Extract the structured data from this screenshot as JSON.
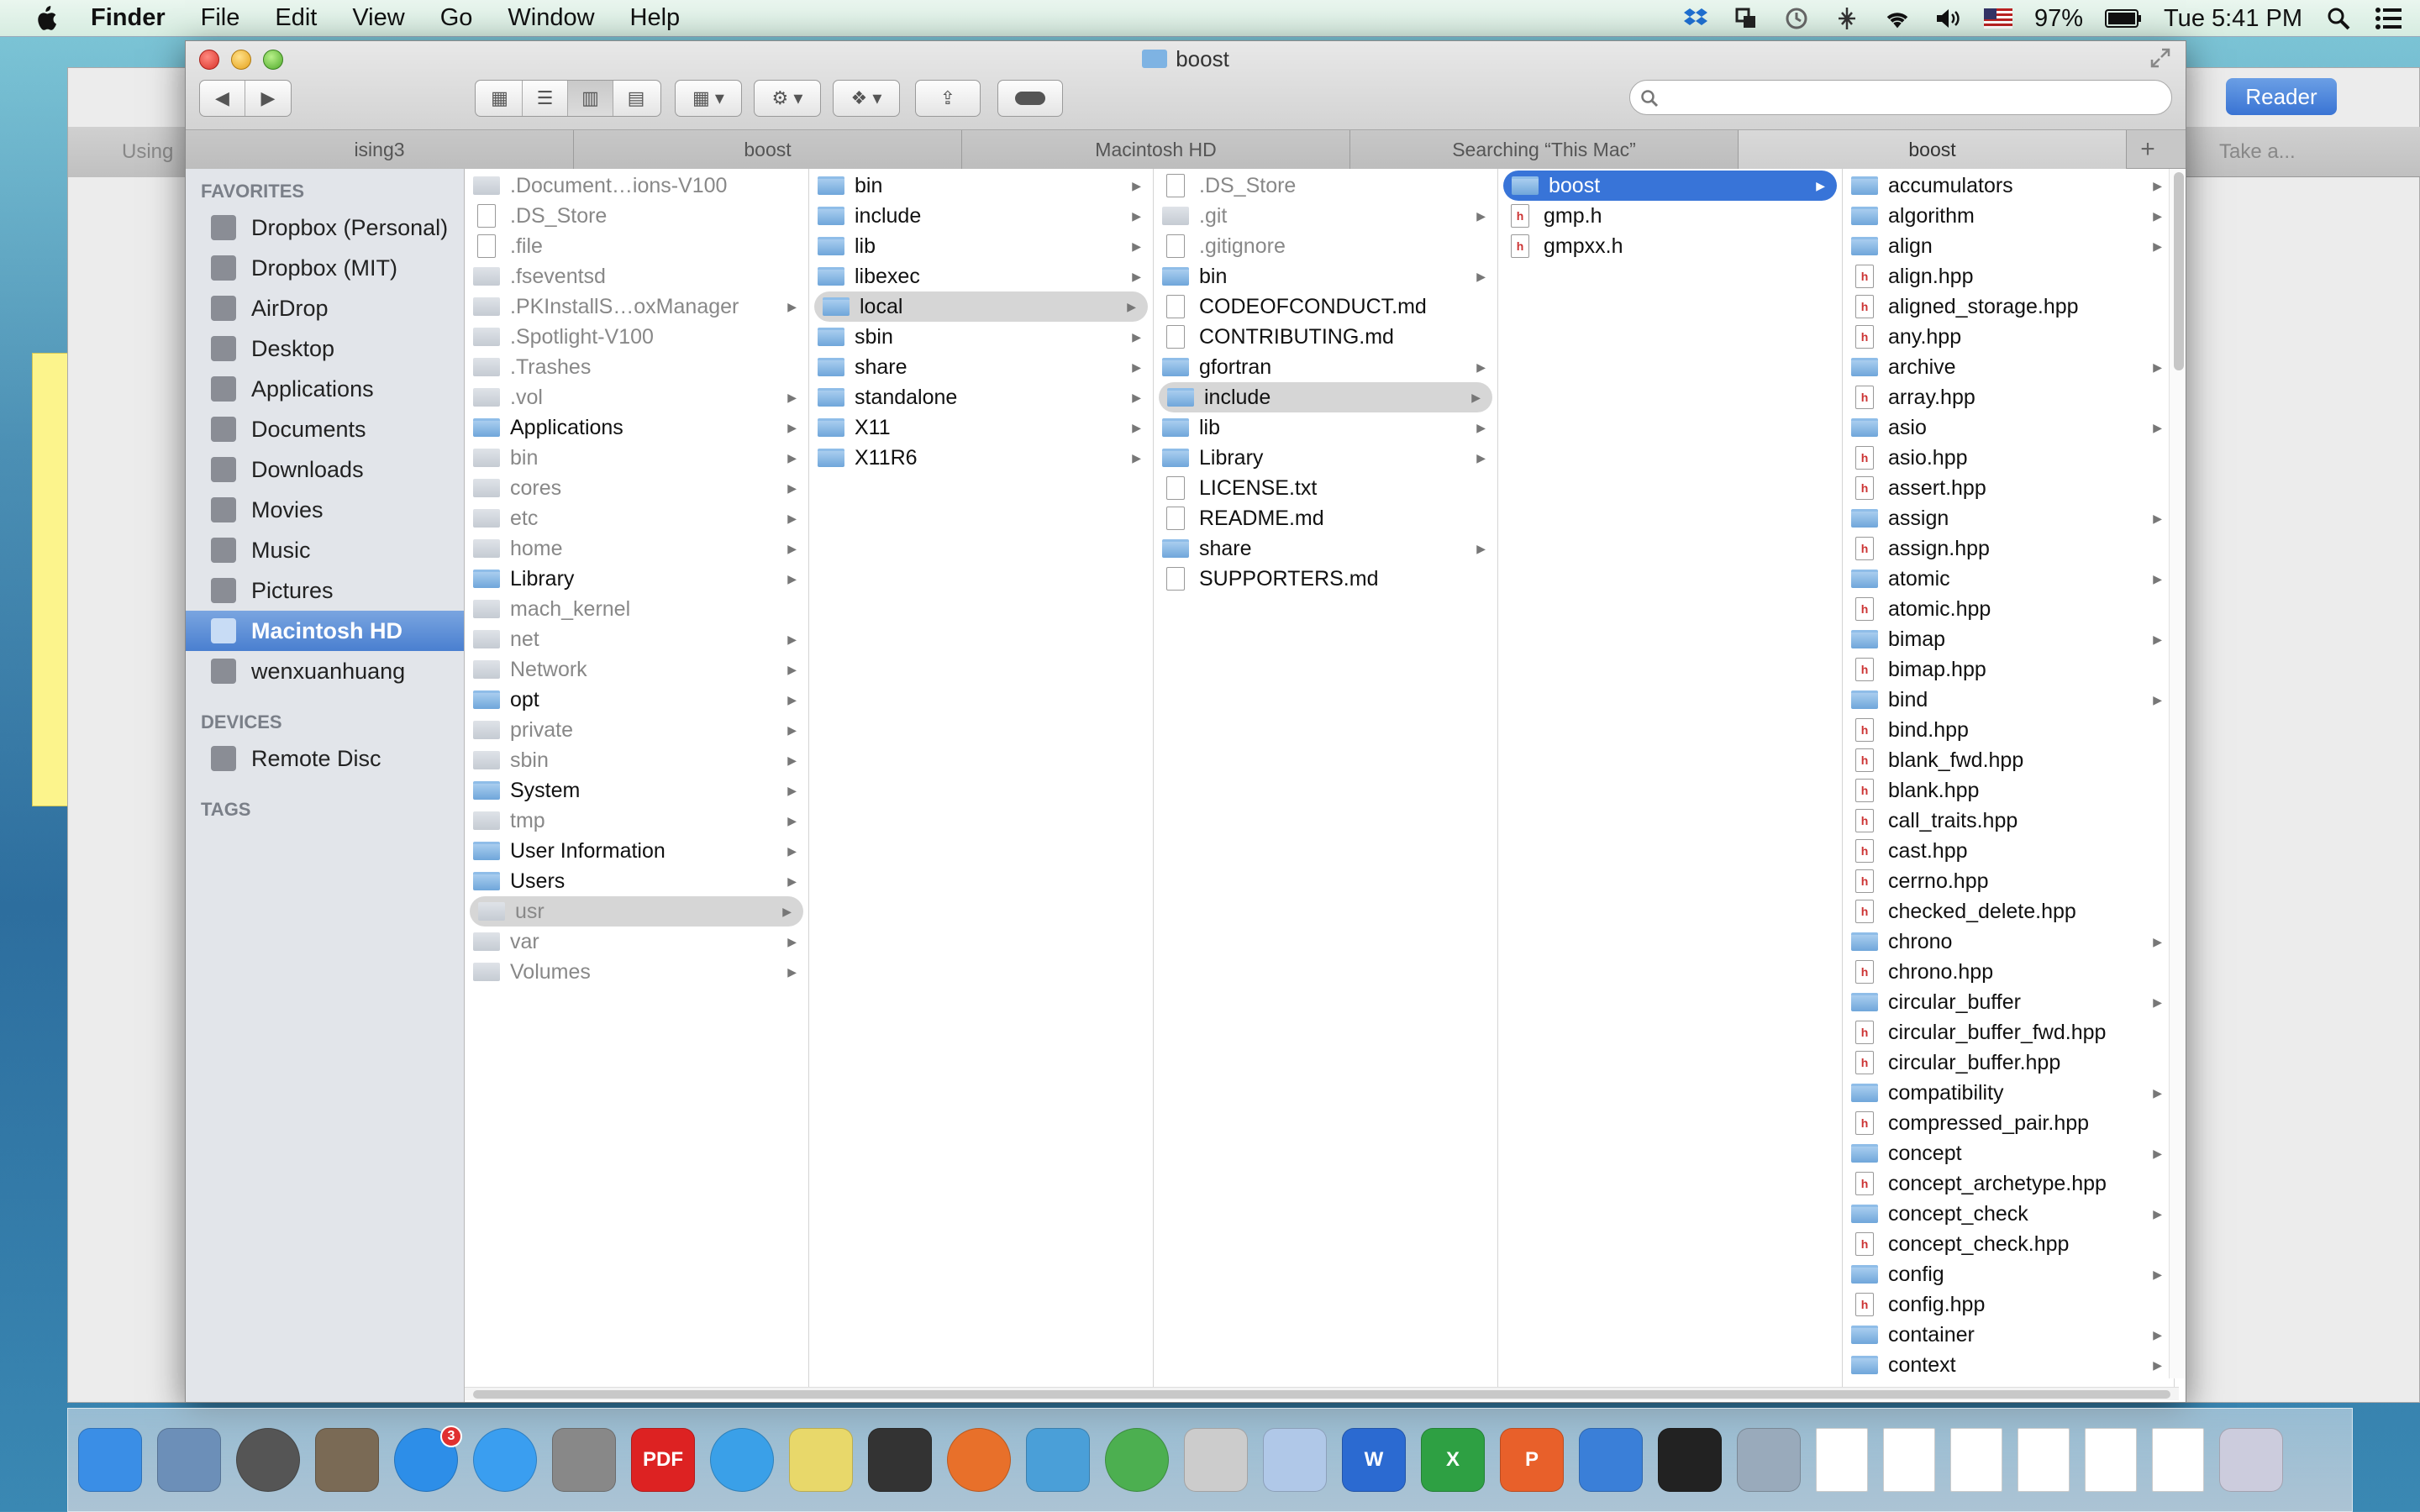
{
  "menubar": {
    "app": "Finder",
    "items": [
      "File",
      "Edit",
      "View",
      "Go",
      "Window",
      "Help"
    ],
    "battery": "97%",
    "clock": "Tue 5:41 PM"
  },
  "window": {
    "title": "boost"
  },
  "bg_right": {
    "tab": "Take a...",
    "reader": "Reader"
  },
  "bg_left": {
    "tab": "Using"
  },
  "tabs": [
    "ising3",
    "boost",
    "Macintosh HD",
    "Searching “This Mac”",
    "boost"
  ],
  "sidebar": {
    "favorites_header": "FAVORITES",
    "favorites": [
      {
        "label": "Dropbox (Personal)",
        "icon": "dropbox-icon"
      },
      {
        "label": "Dropbox (MIT)",
        "icon": "dropbox-icon"
      },
      {
        "label": "AirDrop",
        "icon": "airdrop-icon"
      },
      {
        "label": "Desktop",
        "icon": "desktop-icon"
      },
      {
        "label": "Applications",
        "icon": "applications-icon"
      },
      {
        "label": "Documents",
        "icon": "documents-icon"
      },
      {
        "label": "Downloads",
        "icon": "downloads-icon"
      },
      {
        "label": "Movies",
        "icon": "movies-icon"
      },
      {
        "label": "Music",
        "icon": "music-icon"
      },
      {
        "label": "Pictures",
        "icon": "pictures-icon"
      },
      {
        "label": "Macintosh HD",
        "icon": "harddisk-icon"
      },
      {
        "label": "wenxuanhuang",
        "icon": "home-icon"
      }
    ],
    "devices_header": "DEVICES",
    "devices": [
      {
        "label": "Remote Disc",
        "icon": "disc-icon"
      }
    ],
    "tags_header": "TAGS"
  },
  "columns": [
    [
      {
        "name": ".Document…ions-V100",
        "kind": "gfolder",
        "dim": true
      },
      {
        "name": ".DS_Store",
        "kind": "doc",
        "dim": true
      },
      {
        "name": ".file",
        "kind": "doc",
        "dim": true
      },
      {
        "name": ".fseventsd",
        "kind": "gfolder",
        "dim": true
      },
      {
        "name": ".PKInstallS…oxManager",
        "kind": "gfolder",
        "dim": true,
        "arrow": true
      },
      {
        "name": ".Spotlight-V100",
        "kind": "gfolder",
        "dim": true
      },
      {
        "name": ".Trashes",
        "kind": "gfolder",
        "dim": true
      },
      {
        "name": ".vol",
        "kind": "gfolder",
        "dim": true,
        "arrow": true
      },
      {
        "name": "Applications",
        "kind": "folder",
        "arrow": true
      },
      {
        "name": "bin",
        "kind": "gfolder",
        "dim": true,
        "arrow": true
      },
      {
        "name": "cores",
        "kind": "gfolder",
        "dim": true,
        "arrow": true
      },
      {
        "name": "etc",
        "kind": "gfolder",
        "dim": true,
        "arrow": true
      },
      {
        "name": "home",
        "kind": "gfolder",
        "dim": true,
        "arrow": true
      },
      {
        "name": "Library",
        "kind": "folder",
        "arrow": true
      },
      {
        "name": "mach_kernel",
        "kind": "gfolder",
        "dim": true
      },
      {
        "name": "net",
        "kind": "gfolder",
        "dim": true,
        "arrow": true
      },
      {
        "name": "Network",
        "kind": "gfolder",
        "dim": true,
        "arrow": true
      },
      {
        "name": "opt",
        "kind": "folder",
        "arrow": true
      },
      {
        "name": "private",
        "kind": "gfolder",
        "dim": true,
        "arrow": true
      },
      {
        "name": "sbin",
        "kind": "gfolder",
        "dim": true,
        "arrow": true
      },
      {
        "name": "System",
        "kind": "folder",
        "arrow": true
      },
      {
        "name": "tmp",
        "kind": "gfolder",
        "dim": true,
        "arrow": true
      },
      {
        "name": "User Information",
        "kind": "folder",
        "arrow": true
      },
      {
        "name": "Users",
        "kind": "folder",
        "arrow": true
      },
      {
        "name": "usr",
        "kind": "gfolder",
        "dim": true,
        "arrow": true,
        "state": "hl"
      },
      {
        "name": "var",
        "kind": "gfolder",
        "dim": true,
        "arrow": true
      },
      {
        "name": "Volumes",
        "kind": "gfolder",
        "dim": true,
        "arrow": true
      }
    ],
    [
      {
        "name": "bin",
        "kind": "folder",
        "arrow": true
      },
      {
        "name": "include",
        "kind": "folder",
        "arrow": true
      },
      {
        "name": "lib",
        "kind": "folder",
        "arrow": true
      },
      {
        "name": "libexec",
        "kind": "folder",
        "arrow": true
      },
      {
        "name": "local",
        "kind": "folder",
        "arrow": true,
        "state": "hl"
      },
      {
        "name": "sbin",
        "kind": "folder",
        "arrow": true
      },
      {
        "name": "share",
        "kind": "folder",
        "arrow": true
      },
      {
        "name": "standalone",
        "kind": "folder",
        "arrow": true
      },
      {
        "name": "X11",
        "kind": "folder",
        "arrow": true
      },
      {
        "name": "X11R6",
        "kind": "folder",
        "arrow": true
      }
    ],
    [
      {
        "name": ".DS_Store",
        "kind": "doc",
        "dim": true
      },
      {
        "name": ".git",
        "kind": "gfolder",
        "dim": true,
        "arrow": true
      },
      {
        "name": ".gitignore",
        "kind": "doc",
        "dim": true
      },
      {
        "name": "bin",
        "kind": "folder",
        "arrow": true
      },
      {
        "name": "CODEOFCONDUCT.md",
        "kind": "doc"
      },
      {
        "name": "CONTRIBUTING.md",
        "kind": "doc"
      },
      {
        "name": "gfortran",
        "kind": "folder",
        "arrow": true
      },
      {
        "name": "include",
        "kind": "folder",
        "arrow": true,
        "state": "hl"
      },
      {
        "name": "lib",
        "kind": "folder",
        "arrow": true
      },
      {
        "name": "Library",
        "kind": "folder",
        "arrow": true
      },
      {
        "name": "LICENSE.txt",
        "kind": "doc"
      },
      {
        "name": "README.md",
        "kind": "doc"
      },
      {
        "name": "share",
        "kind": "folder",
        "arrow": true
      },
      {
        "name": "SUPPORTERS.md",
        "kind": "doc"
      }
    ],
    [
      {
        "name": "boost",
        "kind": "folder",
        "arrow": true,
        "state": "sel"
      },
      {
        "name": "gmp.h",
        "kind": "h"
      },
      {
        "name": "gmpxx.h",
        "kind": "h"
      }
    ],
    [
      {
        "name": "accumulators",
        "kind": "folder",
        "arrow": true
      },
      {
        "name": "algorithm",
        "kind": "folder",
        "arrow": true
      },
      {
        "name": "align",
        "kind": "folder",
        "arrow": true
      },
      {
        "name": "align.hpp",
        "kind": "h"
      },
      {
        "name": "aligned_storage.hpp",
        "kind": "h"
      },
      {
        "name": "any.hpp",
        "kind": "h"
      },
      {
        "name": "archive",
        "kind": "folder",
        "arrow": true
      },
      {
        "name": "array.hpp",
        "kind": "h"
      },
      {
        "name": "asio",
        "kind": "folder",
        "arrow": true
      },
      {
        "name": "asio.hpp",
        "kind": "h"
      },
      {
        "name": "assert.hpp",
        "kind": "h"
      },
      {
        "name": "assign",
        "kind": "folder",
        "arrow": true
      },
      {
        "name": "assign.hpp",
        "kind": "h"
      },
      {
        "name": "atomic",
        "kind": "folder",
        "arrow": true
      },
      {
        "name": "atomic.hpp",
        "kind": "h"
      },
      {
        "name": "bimap",
        "kind": "folder",
        "arrow": true
      },
      {
        "name": "bimap.hpp",
        "kind": "h"
      },
      {
        "name": "bind",
        "kind": "folder",
        "arrow": true
      },
      {
        "name": "bind.hpp",
        "kind": "h"
      },
      {
        "name": "blank_fwd.hpp",
        "kind": "h"
      },
      {
        "name": "blank.hpp",
        "kind": "h"
      },
      {
        "name": "call_traits.hpp",
        "kind": "h"
      },
      {
        "name": "cast.hpp",
        "kind": "h"
      },
      {
        "name": "cerrno.hpp",
        "kind": "h"
      },
      {
        "name": "checked_delete.hpp",
        "kind": "h"
      },
      {
        "name": "chrono",
        "kind": "folder",
        "arrow": true
      },
      {
        "name": "chrono.hpp",
        "kind": "h"
      },
      {
        "name": "circular_buffer",
        "kind": "folder",
        "arrow": true
      },
      {
        "name": "circular_buffer_fwd.hpp",
        "kind": "h"
      },
      {
        "name": "circular_buffer.hpp",
        "kind": "h"
      },
      {
        "name": "compatibility",
        "kind": "folder",
        "arrow": true
      },
      {
        "name": "compressed_pair.hpp",
        "kind": "h"
      },
      {
        "name": "concept",
        "kind": "folder",
        "arrow": true
      },
      {
        "name": "concept_archetype.hpp",
        "kind": "h"
      },
      {
        "name": "concept_check",
        "kind": "folder",
        "arrow": true
      },
      {
        "name": "concept_check.hpp",
        "kind": "h"
      },
      {
        "name": "config",
        "kind": "folder",
        "arrow": true
      },
      {
        "name": "config.hpp",
        "kind": "h"
      },
      {
        "name": "container",
        "kind": "folder",
        "arrow": true
      },
      {
        "name": "context",
        "kind": "folder",
        "arrow": true
      }
    ]
  ],
  "dock": [
    {
      "name": "finder",
      "color": "#3a8ee6"
    },
    {
      "name": "mail",
      "color": "#6c8fb8"
    },
    {
      "name": "launchpad",
      "color": "#555"
    },
    {
      "name": "photo-browser",
      "color": "#7a6a55"
    },
    {
      "name": "app-store",
      "color": "#2d8ee8",
      "badge": "3"
    },
    {
      "name": "safari",
      "color": "#3a9ef0"
    },
    {
      "name": "system-preferences",
      "color": "#888"
    },
    {
      "name": "pdf-reader",
      "color": "#d22",
      "label": "PDF"
    },
    {
      "name": "itunes",
      "color": "#3aa0e8"
    },
    {
      "name": "stickies",
      "color": "#e8d86a"
    },
    {
      "name": "activity-monitor",
      "color": "#333"
    },
    {
      "name": "firefox",
      "color": "#e8702a"
    },
    {
      "name": "migration",
      "color": "#4a9fd8"
    },
    {
      "name": "chrome",
      "color": "#4caf50"
    },
    {
      "name": "script-editor",
      "color": "#ccc"
    },
    {
      "name": "textedit",
      "color": "#b0c8e8"
    },
    {
      "name": "word",
      "color": "#2b6ad1",
      "label": "W"
    },
    {
      "name": "excel",
      "color": "#2ea043",
      "label": "X"
    },
    {
      "name": "powerpoint",
      "color": "#e8602a",
      "label": "P"
    },
    {
      "name": "xcode",
      "color": "#3a7fd8"
    },
    {
      "name": "terminal",
      "color": "#222"
    },
    {
      "name": "applications-stack",
      "color": "#9ab"
    },
    {
      "name": "document-1",
      "color": "#fff"
    },
    {
      "name": "document-2",
      "color": "#fff"
    },
    {
      "name": "document-3",
      "color": "#fff"
    },
    {
      "name": "document-4",
      "color": "#fff"
    },
    {
      "name": "document-5",
      "color": "#fff"
    },
    {
      "name": "document-6",
      "color": "#fff"
    },
    {
      "name": "trash",
      "color": "#ccd"
    }
  ]
}
